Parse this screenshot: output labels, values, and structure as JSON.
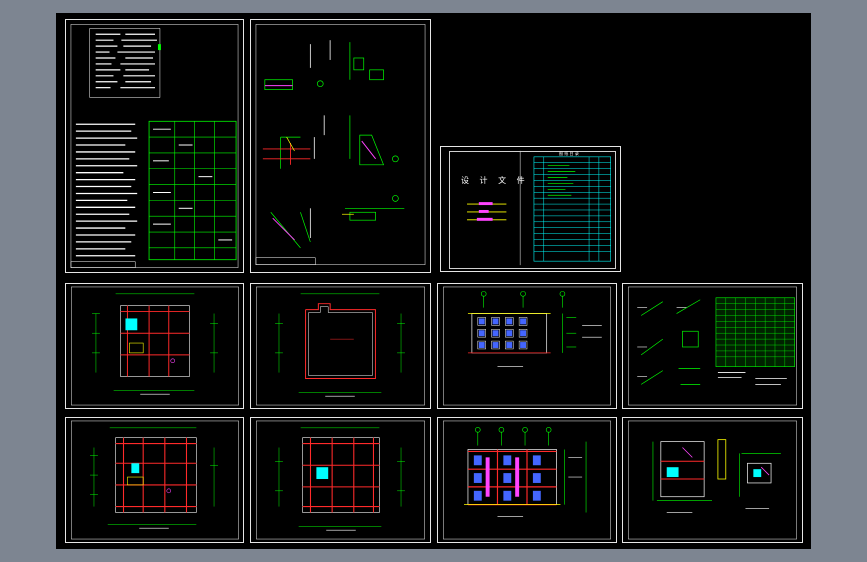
{
  "drawing": {
    "cover_title": "设 计 文 件",
    "list_header": "图 纸 目 录"
  },
  "colors": {
    "background": "#000000",
    "frame": "#e6e6e6",
    "line_green": "#00ff00",
    "line_red": "#ff2a2a",
    "line_yellow": "#ffff00",
    "line_cyan": "#00ffff",
    "line_magenta": "#ff44ff",
    "line_blue": "#4466ff"
  }
}
